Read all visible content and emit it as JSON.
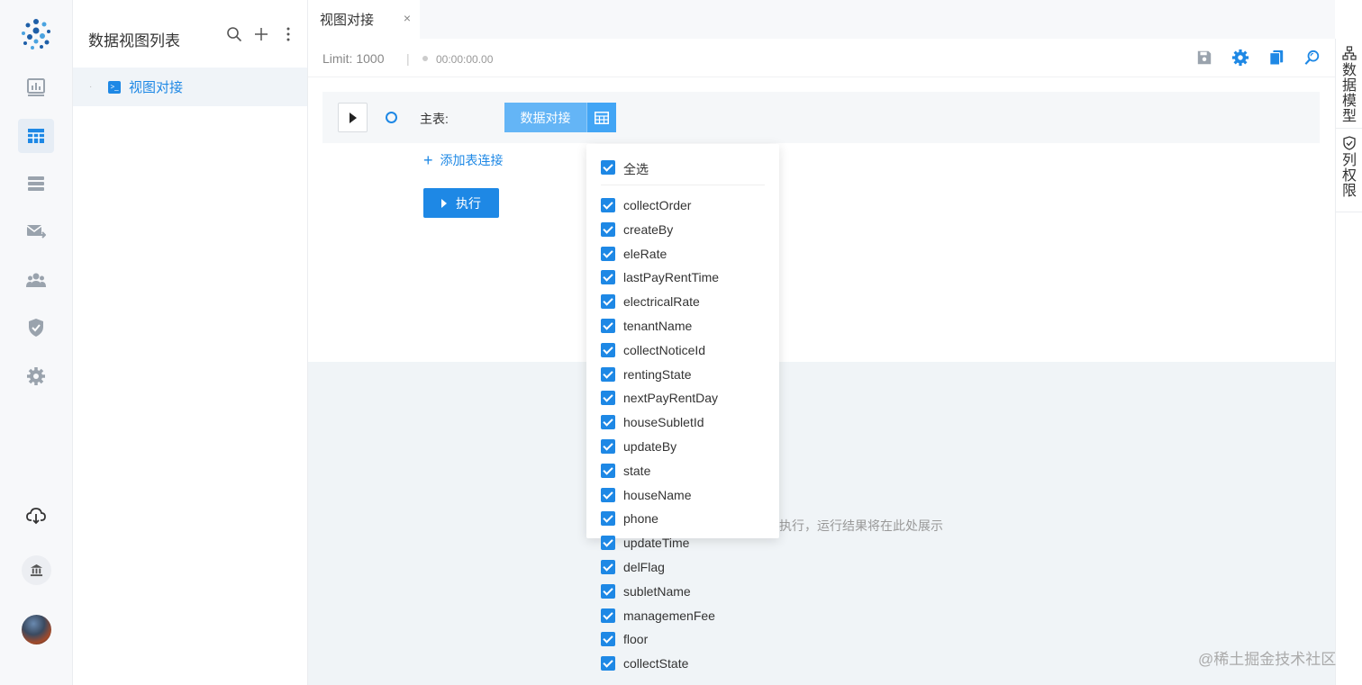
{
  "sidebar": {
    "items": [
      {
        "icon": "dashboard-icon"
      },
      {
        "icon": "table-view-icon",
        "active": true
      },
      {
        "icon": "list-icon"
      },
      {
        "icon": "mail-forward-icon"
      },
      {
        "icon": "users-icon"
      },
      {
        "icon": "shield-icon"
      },
      {
        "icon": "gear-icon"
      }
    ],
    "bottom": [
      {
        "icon": "cloud-download-icon"
      },
      {
        "icon": "bank-icon"
      },
      {
        "icon": "avatar"
      }
    ]
  },
  "list_panel": {
    "title": "数据视图列表",
    "items": [
      {
        "label": "视图对接",
        "selected": true
      }
    ]
  },
  "tabs": [
    {
      "label": "视图对接",
      "close": "×"
    }
  ],
  "toolbar": {
    "limit": "Limit: 1000",
    "separator": "|",
    "timer": "00:00:00.00"
  },
  "editor": {
    "main_table_label": "主表:",
    "main_table_name": "数据对接",
    "add_join": "添加表连接",
    "run_label": "执行"
  },
  "results": {
    "hint": "执行，运行结果将在此处展示"
  },
  "right_rail": {
    "data_model": "数据模型",
    "column_permission": "列权限"
  },
  "column_selector": {
    "select_all": "全选",
    "columns": [
      "collectOrder",
      "createBy",
      "eleRate",
      "lastPayRentTime",
      "electricalRate",
      "tenantName",
      "collectNoticeId",
      "rentingState",
      "nextPayRentDay",
      "houseSubletId",
      "updateBy",
      "state",
      "houseName",
      "phone",
      "updateTime",
      "delFlag",
      "subletName",
      "managemenFee",
      "floor",
      "collectState"
    ]
  },
  "watermark": "@稀土掘金技术社区",
  "colors": {
    "primary": "#1e88e5",
    "chip": "#64b5f6",
    "icon_gray": "#9aa3ad"
  }
}
